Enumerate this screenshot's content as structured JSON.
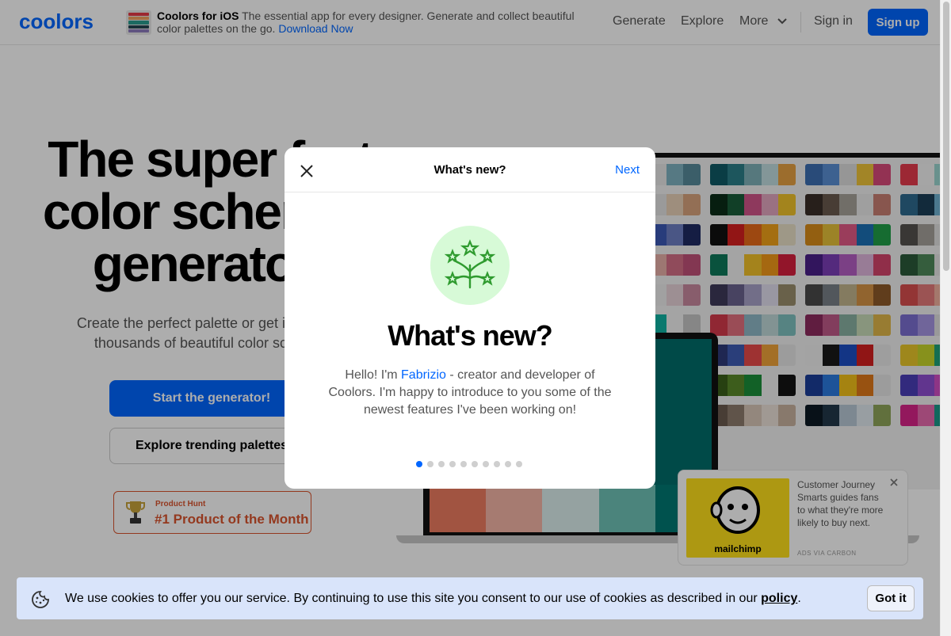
{
  "header": {
    "logo_text": "coolors",
    "ios_title": "Coolors for iOS",
    "ios_desc": "The essential app for every designer. Generate and collect beautiful color palettes on the go.",
    "ios_link": "Download Now",
    "nav": {
      "generate": "Generate",
      "explore": "Explore",
      "more": "More",
      "signin": "Sign in",
      "signup": "Sign up"
    }
  },
  "hero": {
    "title_line1": "The super fast",
    "title_line2": "color schemes",
    "title_line3": "generator!",
    "subtitle": "Create the perfect palette or get inspired by thousands of beautiful color schemes.",
    "primary_button": "Start the generator!",
    "secondary_button": "Explore trending palettes",
    "product_hunt_small": "Product Hunt",
    "product_hunt_big": "#1 Product of the Month"
  },
  "modal": {
    "title": "What's new?",
    "next": "Next",
    "heading": "What's new?",
    "body_prefix": "Hello! I'm ",
    "body_name": "Fabrizio",
    "body_suffix": " - creator and developer of Coolors. I'm happy to introduce to you some of the newest features I've been working on!",
    "steps_total": 10,
    "active_step": 1
  },
  "ad": {
    "brand": "mailchimp",
    "text": "Customer Journey Smarts guides fans to what they're more likely to buy next.",
    "via": "ADS VIA CARBON"
  },
  "cookie": {
    "text": "We use cookies to offer you our service. By continuing to use this site you consent to our use of cookies as described in our",
    "link": "policy",
    "period": ".",
    "button": "Got it"
  },
  "colors": {
    "brand_blue": "#0066ff",
    "product_hunt": "#da552f",
    "badge_green": "#d7fad7",
    "mailchimp_yellow": "#ffe01b"
  }
}
